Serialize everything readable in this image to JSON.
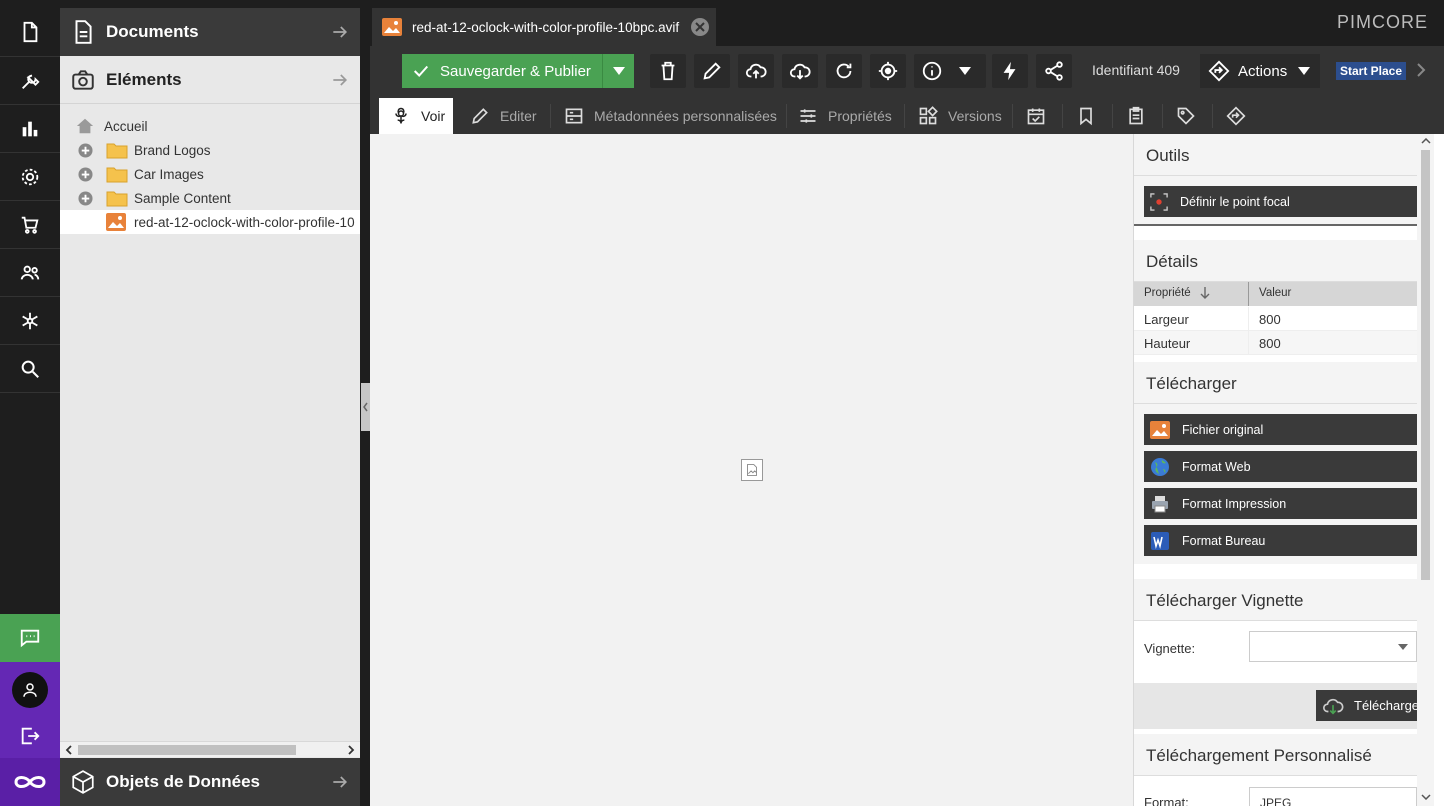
{
  "brand": {
    "logo_text": "PIMCORE"
  },
  "rail": {
    "icons": [
      "document-icon",
      "tools-icon",
      "bar-chart-icon",
      "gear-icon",
      "cart-icon",
      "users-icon",
      "network-icon",
      "search-icon",
      "chat-icon",
      "user-icon",
      "logout-icon",
      "infinity-icon"
    ],
    "accent_green": "#4aa253",
    "accent_purple": "#6428b4"
  },
  "tree": {
    "documents_title": "Documents",
    "elements_title": "Eléments",
    "objects_title": "Objets de Données",
    "items": [
      {
        "label": "Accueil",
        "icon": "home-icon"
      },
      {
        "label": "Brand Logos",
        "icon": "folder-icon"
      },
      {
        "label": "Car Images",
        "icon": "folder-icon"
      },
      {
        "label": "Sample Content",
        "icon": "folder-icon"
      },
      {
        "label": "red-at-12-oclock-with-color-profile-10",
        "icon": "image-icon"
      }
    ]
  },
  "tab": {
    "title": "red-at-12-oclock-with-color-profile-10bpc.avif"
  },
  "toolbar": {
    "save_label": "Sauvegarder & Publier",
    "identifier": "Identifiant 409",
    "actions_label": "Actions",
    "start_place": "Start Place"
  },
  "subtabs": [
    "Voir",
    "Editer",
    "Métadonnées personnalisées",
    "Propriétés",
    "Versions"
  ],
  "side": {
    "tools_title": "Outils",
    "focal_point_label": "Définir le point focal",
    "details_title": "Détails",
    "col_property": "Propriété",
    "col_value": "Valeur",
    "rows": [
      {
        "name": "Largeur",
        "value": "800"
      },
      {
        "name": "Hauteur",
        "value": "800"
      }
    ],
    "download_title": "Télécharger",
    "downloads": [
      "Fichier original",
      "Format Web",
      "Format Impression",
      "Format Bureau"
    ],
    "thumb_title": "Télécharger Vignette",
    "thumb_label": "Vignette:",
    "thumb_button": "Télécharger",
    "custom_title": "Téléchargement Personnalisé",
    "format_label": "Format:",
    "format_value": "JPEG"
  }
}
